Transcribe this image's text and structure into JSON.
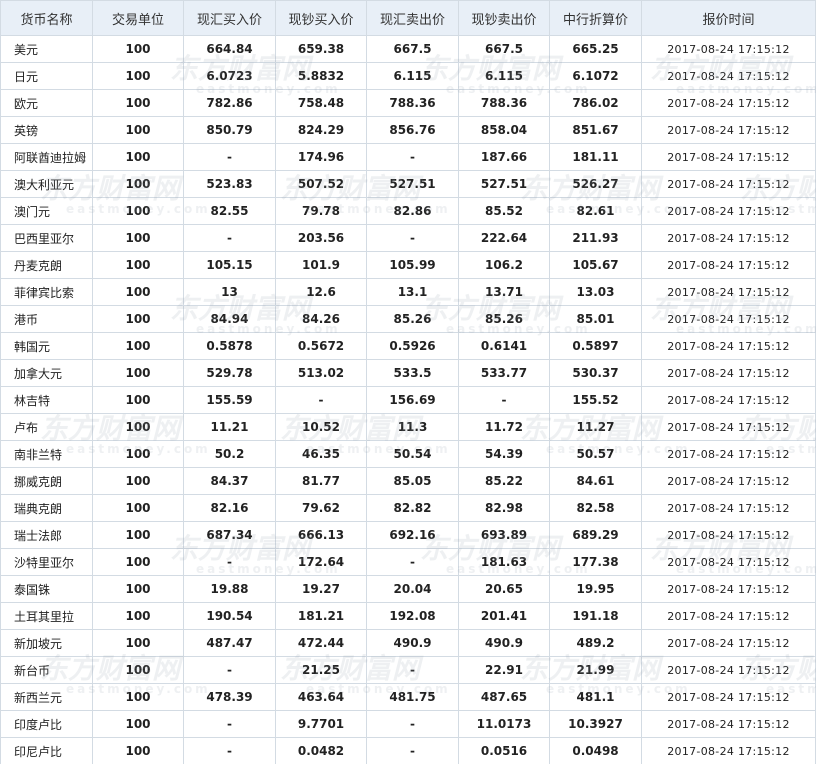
{
  "headers": [
    "货币名称",
    "交易单位",
    "现汇买入价",
    "现钞买入价",
    "现汇卖出价",
    "现钞卖出价",
    "中行折算价",
    "报价时间"
  ],
  "rows": [
    [
      "美元",
      "100",
      "664.84",
      "659.38",
      "667.5",
      "667.5",
      "665.25",
      "2017-08-24 17:15:12"
    ],
    [
      "日元",
      "100",
      "6.0723",
      "5.8832",
      "6.115",
      "6.115",
      "6.1072",
      "2017-08-24 17:15:12"
    ],
    [
      "欧元",
      "100",
      "782.86",
      "758.48",
      "788.36",
      "788.36",
      "786.02",
      "2017-08-24 17:15:12"
    ],
    [
      "英镑",
      "100",
      "850.79",
      "824.29",
      "856.76",
      "858.04",
      "851.67",
      "2017-08-24 17:15:12"
    ],
    [
      "阿联酋迪拉姆",
      "100",
      "-",
      "174.96",
      "-",
      "187.66",
      "181.11",
      "2017-08-24 17:15:12"
    ],
    [
      "澳大利亚元",
      "100",
      "523.83",
      "507.52",
      "527.51",
      "527.51",
      "526.27",
      "2017-08-24 17:15:12"
    ],
    [
      "澳门元",
      "100",
      "82.55",
      "79.78",
      "82.86",
      "85.52",
      "82.61",
      "2017-08-24 17:15:12"
    ],
    [
      "巴西里亚尔",
      "100",
      "-",
      "203.56",
      "-",
      "222.64",
      "211.93",
      "2017-08-24 17:15:12"
    ],
    [
      "丹麦克朗",
      "100",
      "105.15",
      "101.9",
      "105.99",
      "106.2",
      "105.67",
      "2017-08-24 17:15:12"
    ],
    [
      "菲律宾比索",
      "100",
      "13",
      "12.6",
      "13.1",
      "13.71",
      "13.03",
      "2017-08-24 17:15:12"
    ],
    [
      "港币",
      "100",
      "84.94",
      "84.26",
      "85.26",
      "85.26",
      "85.01",
      "2017-08-24 17:15:12"
    ],
    [
      "韩国元",
      "100",
      "0.5878",
      "0.5672",
      "0.5926",
      "0.6141",
      "0.5897",
      "2017-08-24 17:15:12"
    ],
    [
      "加拿大元",
      "100",
      "529.78",
      "513.02",
      "533.5",
      "533.77",
      "530.37",
      "2017-08-24 17:15:12"
    ],
    [
      "林吉特",
      "100",
      "155.59",
      "-",
      "156.69",
      "-",
      "155.52",
      "2017-08-24 17:15:12"
    ],
    [
      "卢布",
      "100",
      "11.21",
      "10.52",
      "11.3",
      "11.72",
      "11.27",
      "2017-08-24 17:15:12"
    ],
    [
      "南非兰特",
      "100",
      "50.2",
      "46.35",
      "50.54",
      "54.39",
      "50.57",
      "2017-08-24 17:15:12"
    ],
    [
      "挪威克朗",
      "100",
      "84.37",
      "81.77",
      "85.05",
      "85.22",
      "84.61",
      "2017-08-24 17:15:12"
    ],
    [
      "瑞典克朗",
      "100",
      "82.16",
      "79.62",
      "82.82",
      "82.98",
      "82.58",
      "2017-08-24 17:15:12"
    ],
    [
      "瑞士法郎",
      "100",
      "687.34",
      "666.13",
      "692.16",
      "693.89",
      "689.29",
      "2017-08-24 17:15:12"
    ],
    [
      "沙特里亚尔",
      "100",
      "-",
      "172.64",
      "-",
      "181.63",
      "177.38",
      "2017-08-24 17:15:12"
    ],
    [
      "泰国铢",
      "100",
      "19.88",
      "19.27",
      "20.04",
      "20.65",
      "19.95",
      "2017-08-24 17:15:12"
    ],
    [
      "土耳其里拉",
      "100",
      "190.54",
      "181.21",
      "192.08",
      "201.41",
      "191.18",
      "2017-08-24 17:15:12"
    ],
    [
      "新加坡元",
      "100",
      "487.47",
      "472.44",
      "490.9",
      "490.9",
      "489.2",
      "2017-08-24 17:15:12"
    ],
    [
      "新台币",
      "100",
      "-",
      "21.25",
      "-",
      "22.91",
      "21.99",
      "2017-08-24 17:15:12"
    ],
    [
      "新西兰元",
      "100",
      "478.39",
      "463.64",
      "481.75",
      "487.65",
      "481.1",
      "2017-08-24 17:15:12"
    ],
    [
      "印度卢比",
      "100",
      "-",
      "9.7701",
      "-",
      "11.0173",
      "10.3927",
      "2017-08-24 17:15:12"
    ],
    [
      "印尼卢比",
      "100",
      "-",
      "0.0482",
      "-",
      "0.0516",
      "0.0498",
      "2017-08-24 17:15:12"
    ]
  ],
  "watermark": {
    "cn": "东方财富网",
    "en": "eastmoney.com"
  }
}
